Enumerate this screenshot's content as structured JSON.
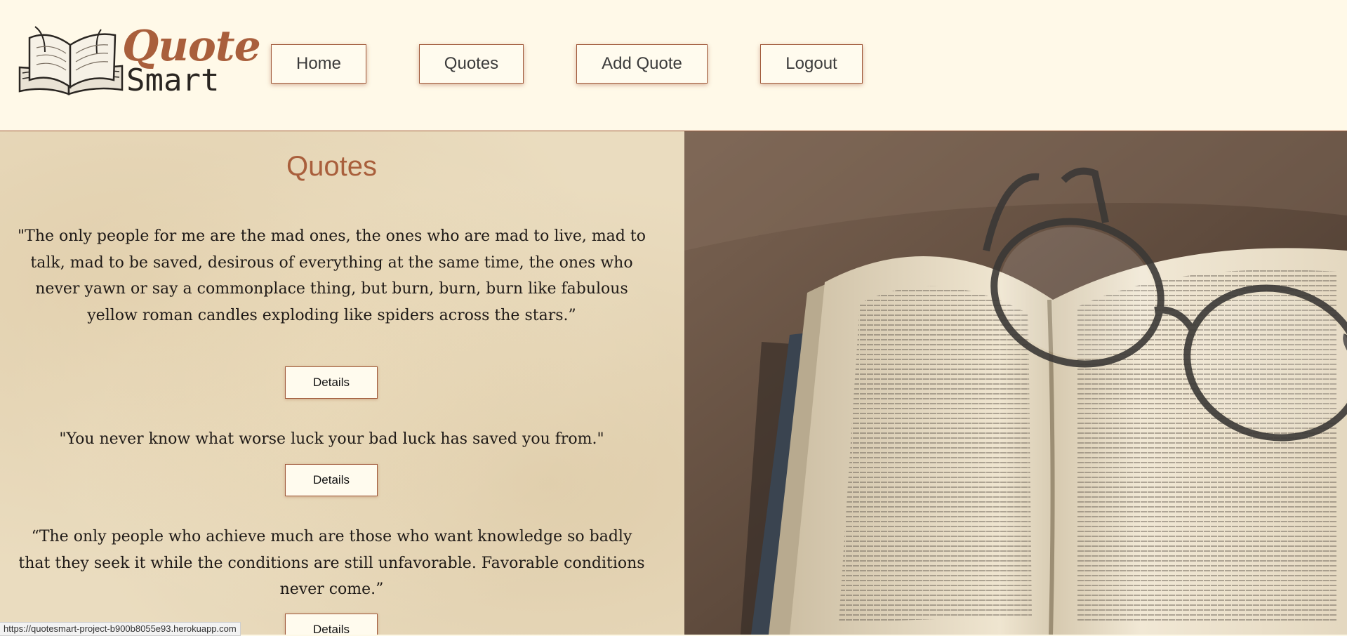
{
  "brand": {
    "name_line1": "Quote",
    "name_line2": "Smart",
    "accent_color": "#a95f3c"
  },
  "nav": {
    "items": [
      {
        "label": "Home"
      },
      {
        "label": "Quotes"
      },
      {
        "label": "Add Quote"
      },
      {
        "label": "Logout"
      }
    ]
  },
  "main": {
    "title": "Quotes",
    "quotes": [
      {
        "text": "\"The only people for me are the mad ones, the ones who are mad to live, mad to talk, mad to be saved, desirous of everything at the same time, the ones who never yawn or say a commonplace thing, but burn, burn, burn like fabulous yellow roman candles exploding like spiders across the stars.”",
        "button_label": "Details"
      },
      {
        "text": "\"You never know what worse luck your bad luck has saved you from.\"",
        "button_label": "Details"
      },
      {
        "text": "“The only people who achieve much are those who want knowledge so badly that they seek it while the conditions are still unfavorable. Favorable conditions never come.”",
        "button_label": "Details"
      }
    ]
  },
  "hero_image": {
    "icon": "open-book-with-glasses-photo"
  },
  "status_bar": {
    "url": "https://quotesmart-project-b900b8055e93.herokuapp.com"
  }
}
